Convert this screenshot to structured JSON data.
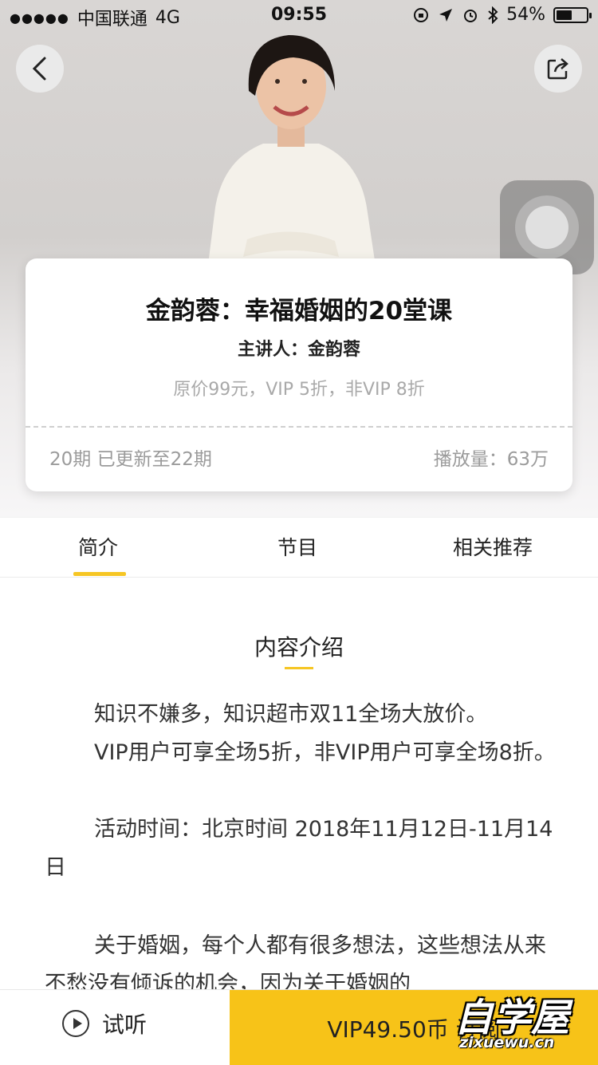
{
  "status_bar": {
    "signal": "●●●●●",
    "carrier": "中国联通",
    "network": "4G",
    "time": "09:55",
    "battery": "54%",
    "battery_level": 0.54
  },
  "icons": {
    "back": "chevron-left-icon",
    "share": "share-icon",
    "assistive_touch": "assistive-touch-icon",
    "play": "play-circle-icon"
  },
  "course": {
    "title": "金韵蓉：幸福婚姻的20堂课",
    "lecturer": "主讲人：金韵蓉",
    "price_note": "原价99元，VIP 5折，非VIP 8折",
    "episodes": "20期 已更新至22期",
    "plays": "播放量：63万"
  },
  "tabs": [
    {
      "label": "简介",
      "active": true
    },
    {
      "label": "节目",
      "active": false
    },
    {
      "label": "相关推荐",
      "active": false
    }
  ],
  "content": {
    "section_title": "内容介绍",
    "paragraphs": [
      "知识不嫌多，知识超市双11全场大放价。",
      "VIP用户可享全场5折，非VIP用户可享全场8折。",
      "活动时间：北京时间 2018年11月12日-11月14日",
      "关于婚姻，每个人都有很多想法，这些想法从来不愁没有倾诉的机会，因为关于婚姻的"
    ]
  },
  "bottom_bar": {
    "listen_label": "试听",
    "buy_label": "VIP49.50币 订阅"
  },
  "watermark": {
    "cn": "自学屋",
    "en": "zixuewu.cn"
  },
  "colors": {
    "accent": "#f7c318",
    "tab_underline": "#f6c624",
    "muted_text": "#9b9b9b"
  }
}
